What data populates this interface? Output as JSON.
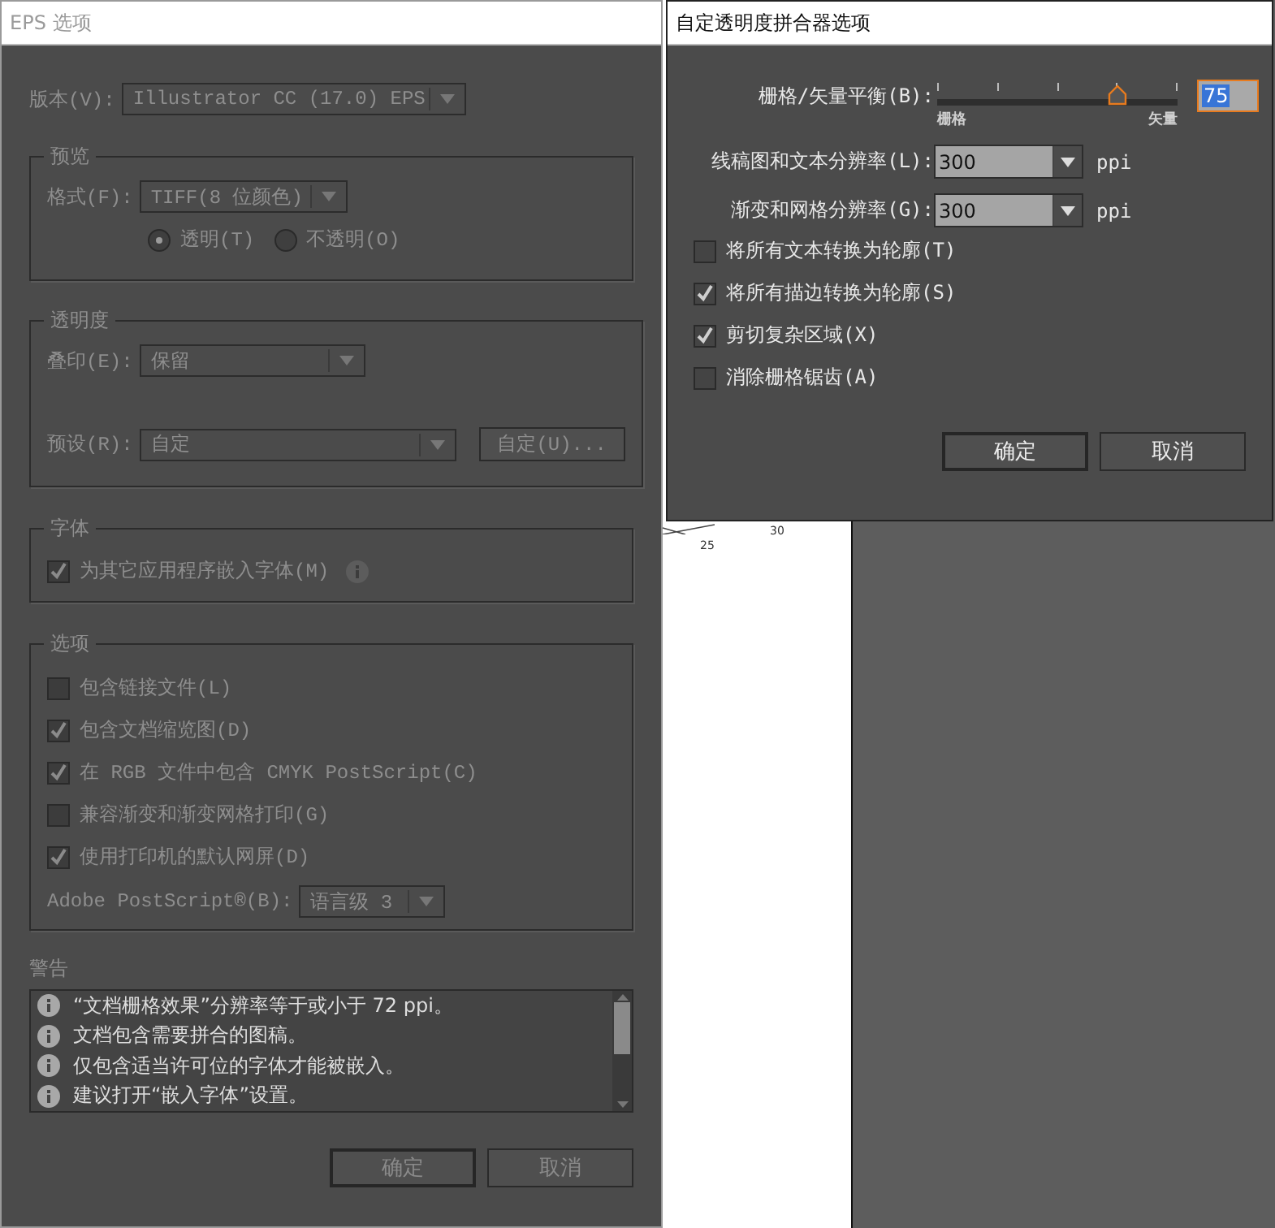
{
  "canvas": {
    "labels": [
      "30",
      "25"
    ]
  },
  "eps_dialog": {
    "title": "EPS 选项",
    "active": false,
    "version": {
      "label": "版本(V):",
      "value": "Illustrator CC (17.0) EPS"
    },
    "preview": {
      "heading": "预览",
      "format": {
        "label": "格式(F):",
        "value": "TIFF(8 位颜色)"
      },
      "radios": [
        {
          "label": "透明(T)",
          "selected": true
        },
        {
          "label": "不透明(O)",
          "selected": false
        }
      ]
    },
    "transparency": {
      "heading": "透明度",
      "overprint": {
        "label": "叠印(E):",
        "value": "保留"
      },
      "preset": {
        "label": "预设(R):",
        "value": "自定"
      },
      "custom_button": "自定(U)..."
    },
    "fonts": {
      "heading": "字体",
      "embed": {
        "label": "为其它应用程序嵌入字体(M)",
        "checked": true
      }
    },
    "options": {
      "heading": "选项",
      "checkboxes": [
        {
          "label": "包含链接文件(L)",
          "checked": false
        },
        {
          "label": "包含文档缩览图(D)",
          "checked": true
        },
        {
          "label": "在 RGB 文件中包含 CMYK PostScript(C)",
          "checked": true
        },
        {
          "label": "兼容渐变和渐变网格打印(G)",
          "checked": false
        },
        {
          "label": "使用打印机的默认网屏(D)",
          "checked": true
        }
      ],
      "postscript": {
        "label": "Adobe PostScript®(B):",
        "value": "语言级 3"
      }
    },
    "warnings": {
      "heading": "警告",
      "items": [
        "“文档栅格效果”分辨率等于或小于  72 ppi。",
        "文档包含需要拼合的图稿。",
        "仅包含适当许可位的字体才能被嵌入。",
        "建议打开“嵌入字体”设置。"
      ]
    },
    "buttons": [
      {
        "label": "确定",
        "default": true
      },
      {
        "label": "取消",
        "default": false
      }
    ]
  },
  "flattener_dialog": {
    "title": "自定透明度拼合器选项",
    "active": true,
    "balance": {
      "label": "栅格/矢量平衡(B):",
      "level": 0.75,
      "value": "75",
      "min_label": "栅格",
      "max_label": "矢量"
    },
    "resolutions": [
      {
        "label": "线稿图和文本分辨率(L):",
        "value": "300",
        "unit": "ppi"
      },
      {
        "label": "渐变和网格分辨率(G):",
        "value": "300",
        "unit": "ppi"
      }
    ],
    "checkboxes": [
      {
        "label": "将所有文本转换为轮廓(T)",
        "checked": false
      },
      {
        "label": "将所有描边转换为轮廓(S)",
        "checked": true
      },
      {
        "label": "剪切复杂区域(X)",
        "checked": true
      },
      {
        "label": "消除栅格锯齿(A)",
        "checked": false
      }
    ],
    "buttons": [
      {
        "label": "确定",
        "default": true
      },
      {
        "label": "取消",
        "default": false
      }
    ]
  }
}
